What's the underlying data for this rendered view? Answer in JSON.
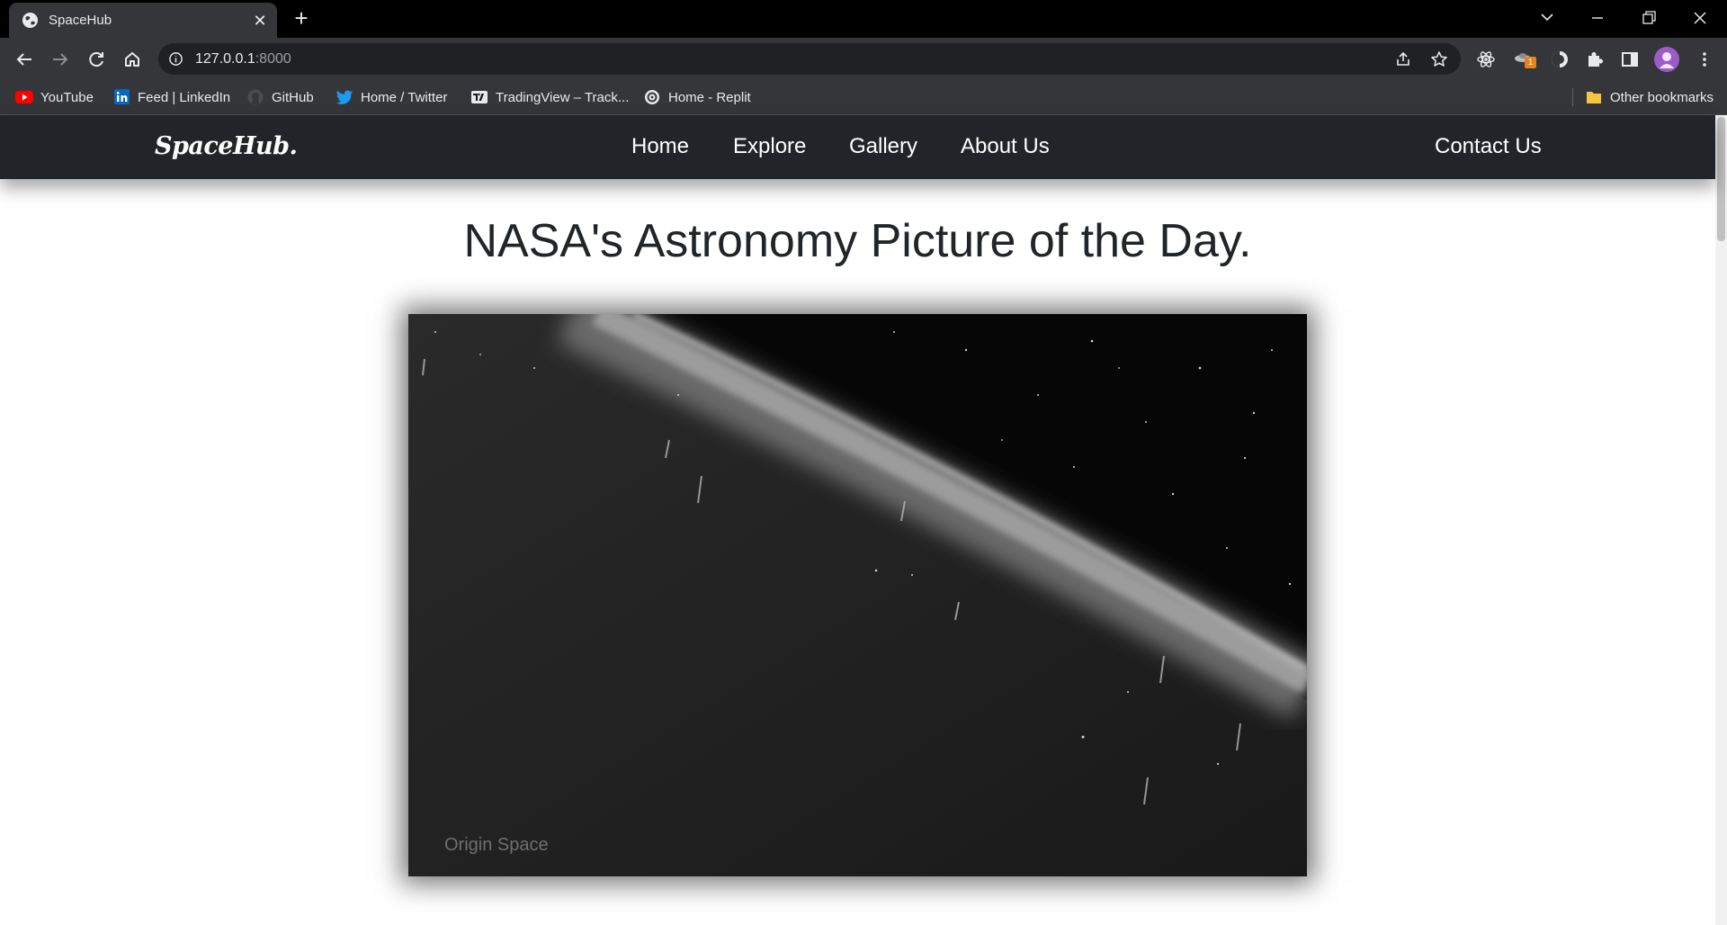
{
  "browser": {
    "tab": {
      "title": "SpaceHub",
      "favicon": "globe-icon"
    },
    "url": {
      "host": "127.0.0.1",
      "port": ":8000"
    },
    "bookmarks": [
      {
        "label": "YouTube",
        "icon": "youtube-icon"
      },
      {
        "label": "Feed | LinkedIn",
        "icon": "linkedin-icon"
      },
      {
        "label": "GitHub",
        "icon": "github-icon"
      },
      {
        "label": "Home / Twitter",
        "icon": "twitter-icon"
      },
      {
        "label": "TradingView – Track...",
        "icon": "tradingview-icon"
      },
      {
        "label": "Home - Replit",
        "icon": "replit-icon"
      }
    ],
    "other_bookmarks": "Other bookmarks",
    "extension_badge": "1"
  },
  "site": {
    "brand": "SpaceHub.",
    "nav": [
      "Home",
      "Explore",
      "Gallery",
      "About Us"
    ],
    "contact": "Contact Us"
  },
  "main": {
    "title": "NASA's Astronomy Picture of the Day.",
    "image_credit": "Origin Space"
  },
  "colors": {
    "tab_strip": "#000000",
    "toolbar": "#35363a",
    "site_nav": "#212529",
    "headline": "#212529"
  }
}
